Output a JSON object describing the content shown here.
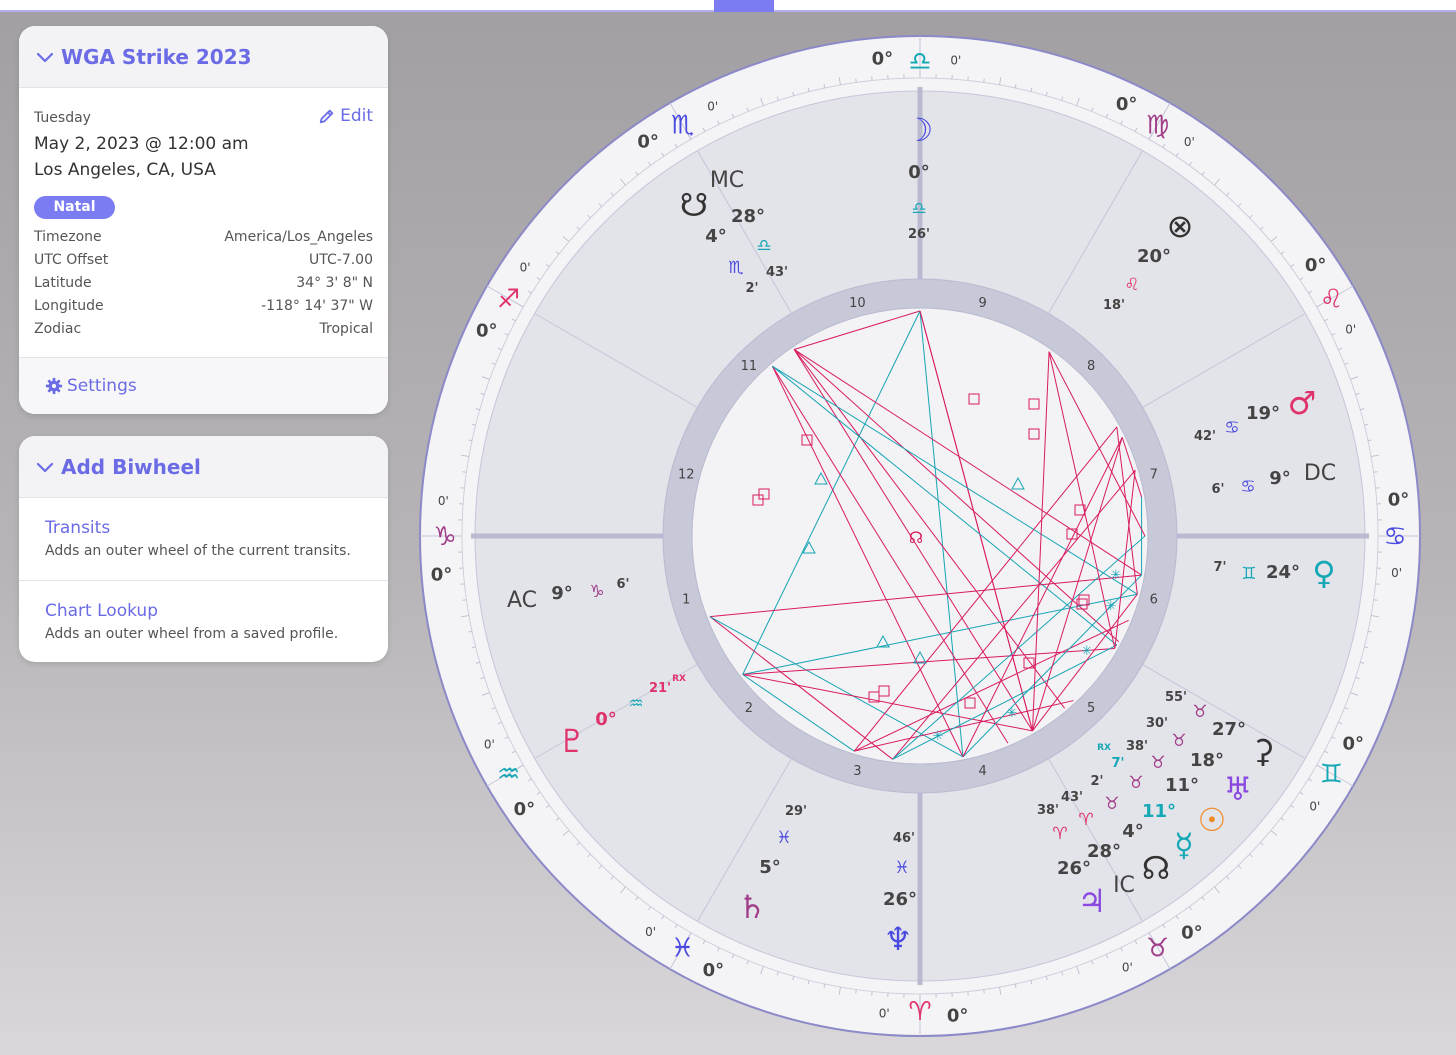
{
  "profile": {
    "title": "WGA Strike 2023",
    "weekday": "Tuesday",
    "edit_label": "Edit",
    "datetime": "May 2, 2023 @ 12:00 am",
    "location": "Los Angeles, CA, USA",
    "badge": "Natal",
    "properties": [
      {
        "label": "Timezone",
        "value": "America/Los_Angeles"
      },
      {
        "label": "UTC Offset",
        "value": "UTC-7.00"
      },
      {
        "label": "Latitude",
        "value": "34° 3' 8\" N"
      },
      {
        "label": "Longitude",
        "value": "-118° 14' 37\" W"
      },
      {
        "label": "Zodiac",
        "value": "Tropical"
      }
    ],
    "settings_label": "Settings"
  },
  "biwheel": {
    "title": "Add Biwheel",
    "items": [
      {
        "title": "Transits",
        "desc": "Adds an outer wheel of the current transits."
      },
      {
        "title": "Chart Lookup",
        "desc": "Adds an outer wheel from a saved profile."
      }
    ]
  },
  "chart": {
    "zero_deg": "0°",
    "zero_min": "0'",
    "signs": [
      {
        "name": "libra",
        "glyph": "♎",
        "color": "#17a8b5"
      },
      {
        "name": "virgo",
        "glyph": "♍",
        "color": "#a03e8a"
      },
      {
        "name": "leo",
        "glyph": "♌",
        "color": "#e0336b"
      },
      {
        "name": "cancer",
        "glyph": "♋",
        "color": "#4a4ae0"
      },
      {
        "name": "gemini",
        "glyph": "♊",
        "color": "#17a8b5"
      },
      {
        "name": "taurus",
        "glyph": "♉",
        "color": "#a03e8a"
      },
      {
        "name": "aries",
        "glyph": "♈",
        "color": "#e0336b"
      },
      {
        "name": "pisces",
        "glyph": "♓",
        "color": "#4a4ae0"
      },
      {
        "name": "aquarius",
        "glyph": "♒",
        "color": "#17a8b5"
      },
      {
        "name": "capricorn",
        "glyph": "♑",
        "color": "#a03e8a"
      },
      {
        "name": "sagittarius",
        "glyph": "♐",
        "color": "#e0336b"
      },
      {
        "name": "scorpio",
        "glyph": "♏",
        "color": "#4a4ae0"
      }
    ],
    "houses": [
      "1",
      "2",
      "3",
      "4",
      "5",
      "6",
      "7",
      "8",
      "9",
      "10",
      "11",
      "12"
    ],
    "center_glyph": "☊",
    "points": [
      {
        "name": "moon",
        "glyph": "☽",
        "gcolor": "#4a4ae0",
        "deg": "0°",
        "sign": "♎",
        "scolor": "#17a8b5",
        "min": "26'"
      },
      {
        "name": "node-mc",
        "glyph": "☋",
        "gcolor": "#333",
        "label": "MC",
        "deg": "28°",
        "deg2": "4°",
        "sign": "♎",
        "sign2": "♏",
        "scolor": "#17a8b5",
        "scolor2": "#4a4ae0",
        "min": "43'",
        "min2": "2'"
      },
      {
        "name": "fortune",
        "glyph": "⊗",
        "gcolor": "#333",
        "deg": "20°",
        "sign": "♌",
        "scolor": "#e0336b",
        "min": "18'"
      },
      {
        "name": "mars",
        "glyph": "♂",
        "gcolor": "#e0336b",
        "deg": "19°",
        "sign": "♋",
        "scolor": "#4a4ae0",
        "min": "42'"
      },
      {
        "name": "dc",
        "label": "DC",
        "deg": "9°",
        "sign": "♋",
        "scolor": "#4a4ae0",
        "min": "6'"
      },
      {
        "name": "venus",
        "glyph": "♀",
        "gcolor": "#17a8b5",
        "deg": "24°",
        "sign": "♊",
        "scolor": "#17a8b5",
        "min": "7'"
      },
      {
        "name": "ac",
        "label": "AC",
        "deg": "9°",
        "sign": "♑",
        "scolor": "#a03e8a",
        "min": "6'"
      },
      {
        "name": "pluto",
        "glyph": "♇",
        "gcolor": "#e0336b",
        "deg": "0°",
        "sign": "♒",
        "scolor": "#17a8b5",
        "min": "21'",
        "rx": "RX"
      },
      {
        "name": "saturn",
        "glyph": "♄",
        "gcolor": "#a03e8a",
        "deg": "5°",
        "sign": "♓",
        "scolor": "#4a4ae0",
        "min": "29'"
      },
      {
        "name": "neptune",
        "glyph": "♆",
        "gcolor": "#4a4ae0",
        "deg": "26°",
        "sign": "♓",
        "scolor": "#4a4ae0",
        "min": "46'"
      },
      {
        "name": "ceres",
        "glyph": "⚳",
        "gcolor": "#333",
        "deg": "27°",
        "sign": "♉",
        "scolor": "#a03e8a",
        "min": "55'"
      },
      {
        "name": "uranus",
        "glyph": "♅",
        "gcolor": "#8a4ae0",
        "deg": "18°",
        "sign": "♉",
        "scolor": "#a03e8a",
        "min": "30'"
      },
      {
        "name": "sun",
        "glyph": "☉",
        "gcolor": "#f08a24",
        "deg": "11°",
        "sign": "♉",
        "scolor": "#a03e8a",
        "min": "38'"
      },
      {
        "name": "mercury",
        "glyph": "☿",
        "gcolor": "#17a8b5",
        "deg": "11°",
        "sign": "♉",
        "scolor": "#a03e8a",
        "min": "7'",
        "rx": "RX"
      },
      {
        "name": "north-node",
        "glyph": "☊",
        "gcolor": "#333",
        "deg": "4°",
        "sign": "♉",
        "scolor": "#a03e8a",
        "min": "2'"
      },
      {
        "name": "ic",
        "label": "IC",
        "deg": "28°",
        "sign": "♈",
        "scolor": "#e0336b",
        "min": "43'"
      },
      {
        "name": "jupiter",
        "glyph": "♃",
        "gcolor": "#8a4ae0",
        "deg": "26°",
        "sign": "♈",
        "scolor": "#e0336b",
        "min": "38'"
      }
    ]
  }
}
